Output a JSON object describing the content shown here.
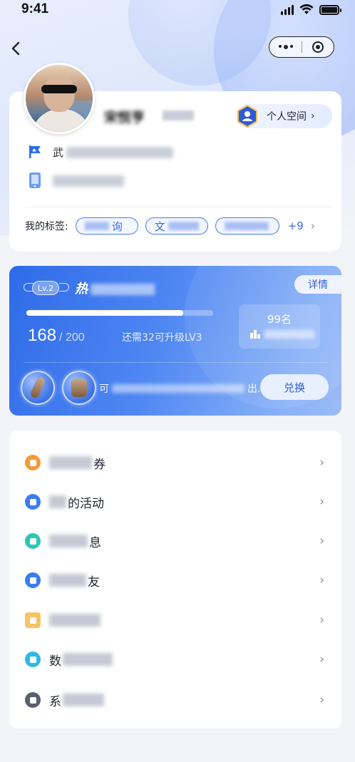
{
  "status_bar": {
    "time": "9:41"
  },
  "nav": {
    "back_icon": "chevron-left-icon",
    "capsule_more_icon": "more-dots-icon",
    "capsule_close_icon": "record-circle-icon"
  },
  "profile": {
    "name_visible": "宋悦亨",
    "personal_space_label": "个人空间",
    "company_icon": "flag-icon",
    "company_visible": "武",
    "phone_icon": "phone-icon",
    "tags_title": "我的标签:",
    "tags": [
      {
        "visible": "询"
      },
      {
        "visible": "文"
      },
      {
        "visible": ""
      }
    ],
    "tags_more": "+9"
  },
  "level_card": {
    "level_badge": "Lv.2",
    "title_visible": "热",
    "detail_label": "详情",
    "progress": {
      "current": 168,
      "total": 200,
      "fraction": 0.84
    },
    "score_current": "168",
    "score_total": "/ 200",
    "upgrade_hint": "还需32可升级LV3",
    "rank": "99名",
    "exchange_text_prefix": "可",
    "exchange_text_suffix": "出...",
    "exchange_label": "兑换",
    "colors": {
      "gradient_start": "#2f6be8",
      "gradient_end": "#9dbbf6"
    }
  },
  "menu": [
    {
      "label_visible": "券",
      "icon": "coupon-icon",
      "color": "#f39a3a"
    },
    {
      "label_visible": "的活动",
      "icon": "activity-icon",
      "color": "#3d7cf0"
    },
    {
      "label_visible": "息",
      "icon": "message-icon",
      "color": "#2ec7b5"
    },
    {
      "label_visible": "友",
      "icon": "friend-icon",
      "color": "#3d7cf0"
    },
    {
      "label_visible": "",
      "icon": "folder-icon",
      "color": "#f7c365"
    },
    {
      "label_visible": "数",
      "icon": "chart-icon",
      "color": "#2fb9e6"
    },
    {
      "label_visible": "系",
      "icon": "settings-icon",
      "color": "#5a5f6b"
    }
  ]
}
